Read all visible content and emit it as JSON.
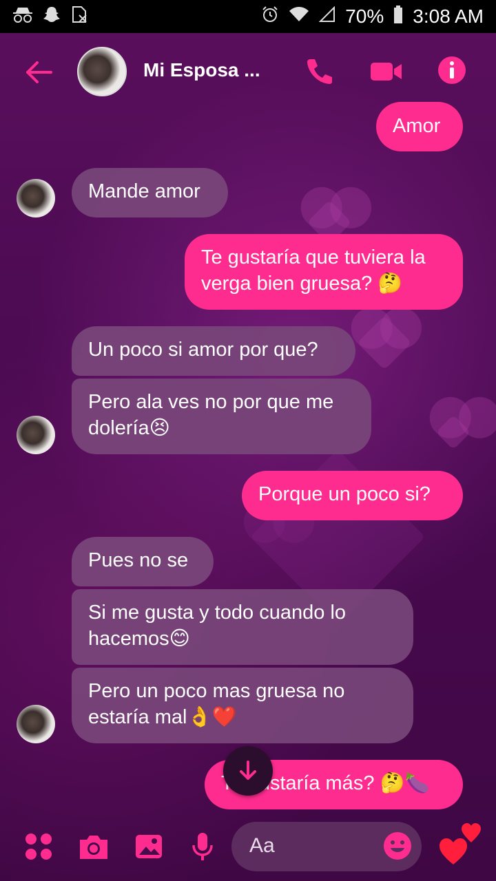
{
  "status_bar": {
    "battery": "70%",
    "time": "3:08 AM"
  },
  "header": {
    "contact_name": "Mi Esposa ..."
  },
  "messages": [
    {
      "side": "sent",
      "text": "Amor"
    },
    {
      "side": "received",
      "text": "Mande amor"
    },
    {
      "side": "sent",
      "text": "Te gustaría que tuviera la verga bien gruesa? 🤔"
    },
    {
      "side": "received",
      "text": "Un poco si amor por que?"
    },
    {
      "side": "received",
      "text": "Pero ala ves no por que me dolería😣"
    },
    {
      "side": "sent",
      "text": "Porque un poco si?"
    },
    {
      "side": "received",
      "text": "Pues no se"
    },
    {
      "side": "received",
      "text": "Si me gusta y todo cuando lo hacemos😊"
    },
    {
      "side": "received",
      "text": "Pero un poco mas gruesa no estaría mal👌❤️"
    },
    {
      "side": "sent",
      "text": "Te gustaría más? 🤔🍆"
    }
  ],
  "composer": {
    "placeholder": "Aa"
  },
  "colors": {
    "accent": "#ff2c8f",
    "received_bubble": "#78467a",
    "background": "#4a0b4d"
  },
  "icons": [
    "incognito-icon",
    "snapchat-icon",
    "no-sim-icon",
    "alarm-icon",
    "wifi-icon",
    "signal-icon",
    "battery-icon",
    "back-arrow-icon",
    "phone-icon",
    "video-camera-icon",
    "info-icon",
    "scroll-down-icon",
    "apps-icon",
    "camera-icon",
    "gallery-icon",
    "microphone-icon",
    "emoji-icon",
    "hearts-icon"
  ]
}
